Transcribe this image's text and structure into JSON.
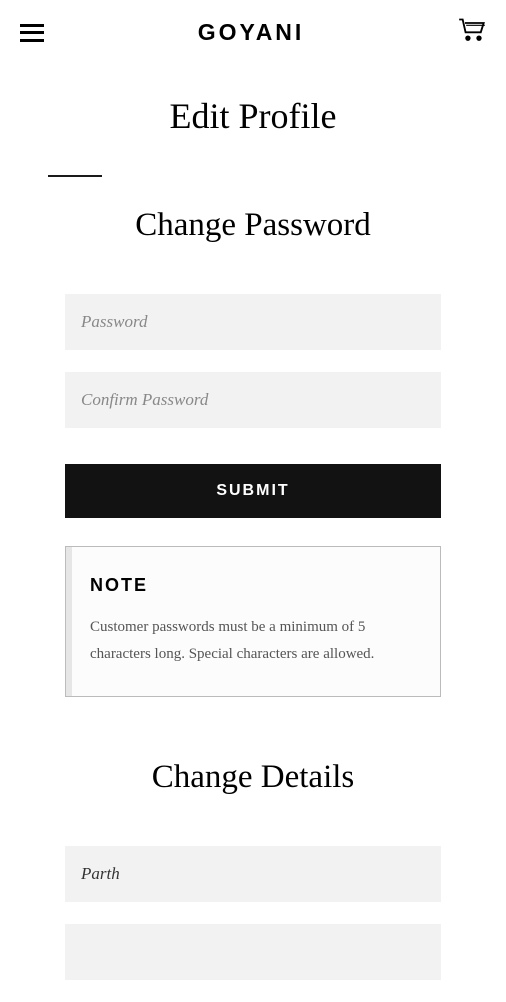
{
  "header": {
    "logo": "GOYANI"
  },
  "page_title": "Edit Profile",
  "change_password": {
    "title": "Change Password",
    "password_placeholder": "Password",
    "confirm_placeholder": "Confirm Password",
    "submit_label": "SUBMIT",
    "note_title": "NOTE",
    "note_text": "Customer passwords must be a minimum of 5 characters long. Special characters are allowed."
  },
  "change_details": {
    "title": "Change Details",
    "name_value": "Parth"
  }
}
